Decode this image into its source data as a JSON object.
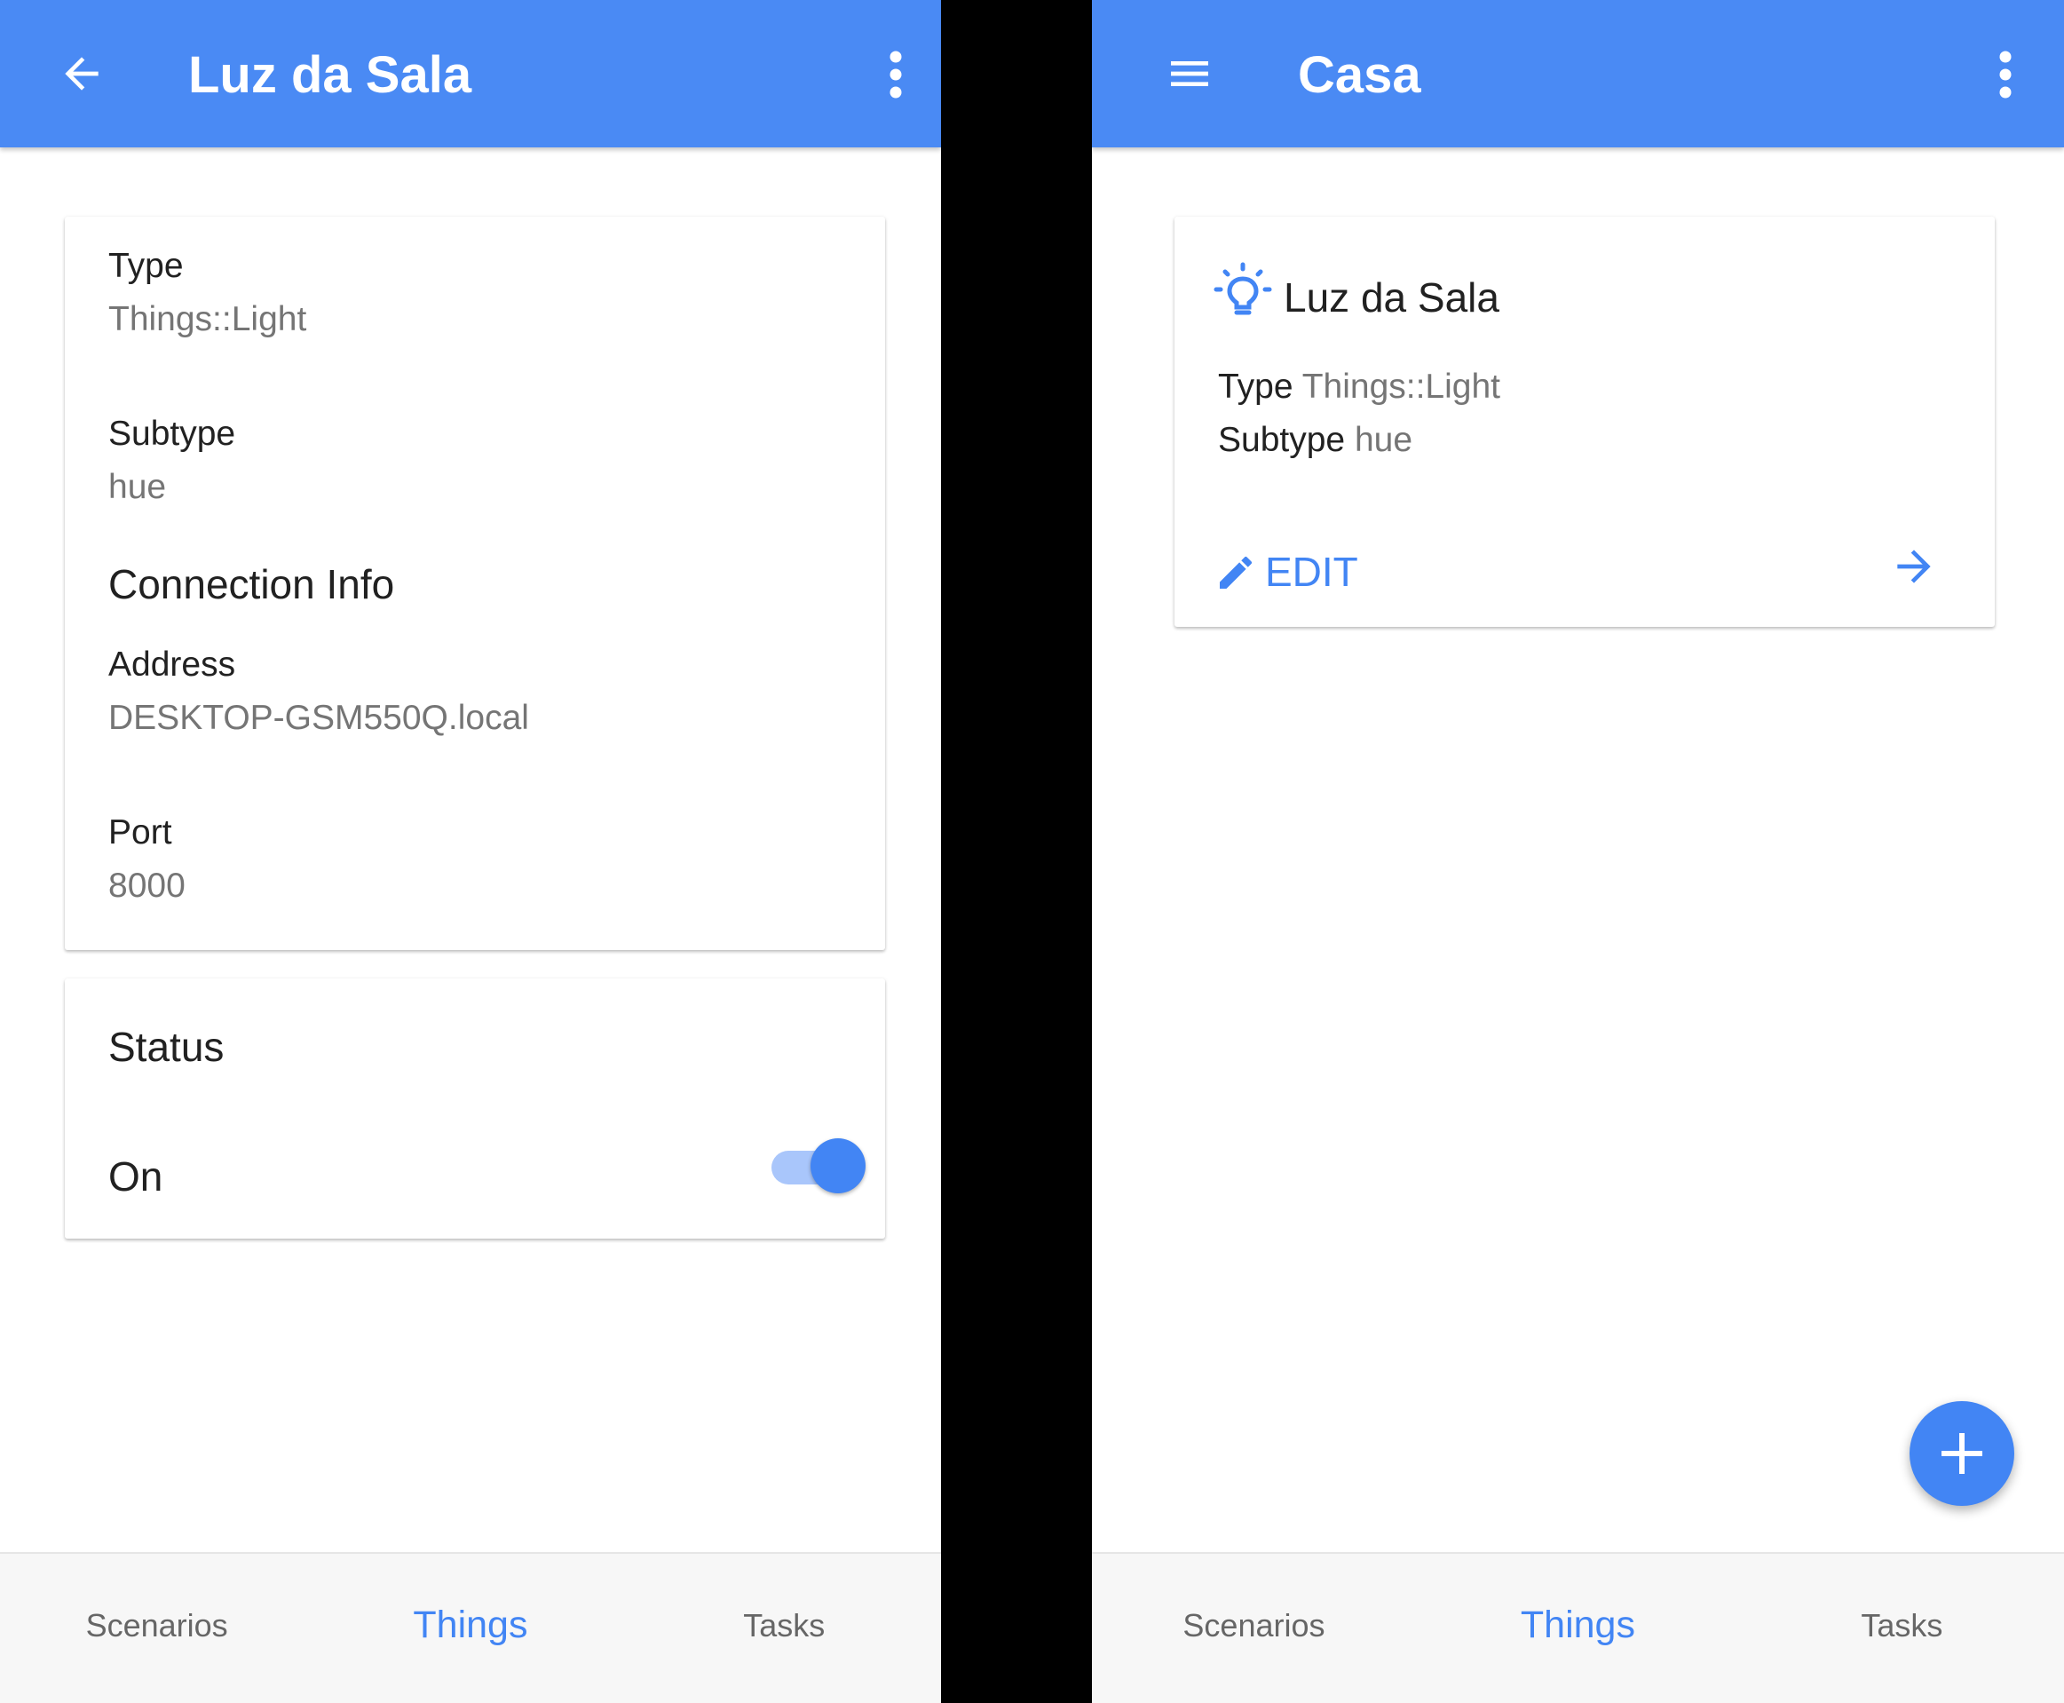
{
  "left_screen": {
    "appbar": {
      "title": "Luz da Sala",
      "back_icon": "arrow-back-icon",
      "more_icon": "more-vert-icon"
    },
    "details": {
      "type_label": "Type",
      "type_value": "Things::Light",
      "subtype_label": "Subtype",
      "subtype_value": "hue",
      "connection_heading": "Connection Info",
      "address_label": "Address",
      "address_value": "DESKTOP-GSM550Q.local",
      "port_label": "Port",
      "port_value": "8000"
    },
    "status": {
      "heading": "Status",
      "state_label": "On",
      "is_on": true
    }
  },
  "right_screen": {
    "appbar": {
      "title": "Casa",
      "menu_icon": "menu-icon",
      "more_icon": "more-vert-icon"
    },
    "thing_card": {
      "icon": "lightbulb-icon",
      "name": "Luz da Sala",
      "type_label": "Type",
      "type_value": "Things::Light",
      "subtype_label": "Subtype",
      "subtype_value": "hue",
      "edit_label": "EDIT",
      "open_icon": "arrow-forward-icon"
    },
    "fab_icon": "plus-icon"
  },
  "bottom_nav": {
    "tabs": [
      {
        "label": "Scenarios",
        "active": false
      },
      {
        "label": "Things",
        "active": true
      },
      {
        "label": "Tasks",
        "active": false
      }
    ]
  },
  "colors": {
    "primary": "#4a8af4",
    "accent": "#4285f4",
    "toggle_track": "#a9c6fb",
    "secondary_text": "#757575",
    "divider_background": "#000000"
  }
}
